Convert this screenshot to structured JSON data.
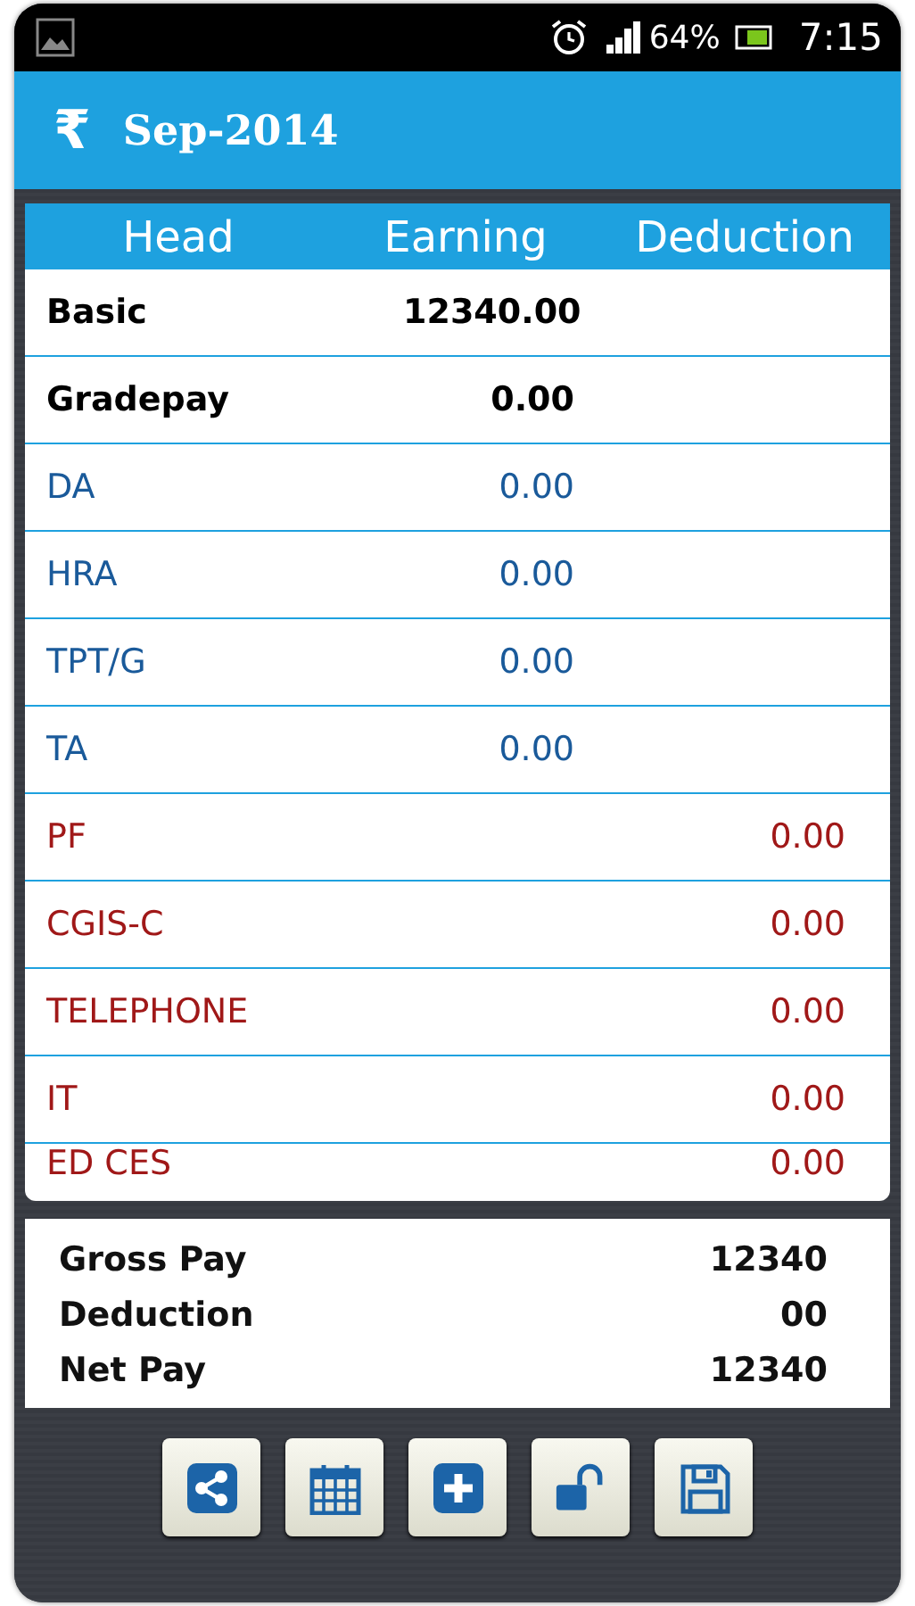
{
  "status_bar": {
    "battery": "64%",
    "time": "7:15"
  },
  "app_bar": {
    "currency_symbol": "₹",
    "title": "Sep-2014"
  },
  "table": {
    "columns": [
      "Head",
      "Earning",
      "Deduction"
    ],
    "rows": [
      {
        "kind": "basic",
        "head": "Basic",
        "earning": "12340.00"
      },
      {
        "kind": "basic",
        "head": "Gradepay",
        "earning": "0.00"
      },
      {
        "kind": "earning",
        "head": "DA",
        "earning": "0.00"
      },
      {
        "kind": "earning",
        "head": "HRA",
        "earning": "0.00"
      },
      {
        "kind": "earning",
        "head": "TPT/G",
        "earning": "0.00"
      },
      {
        "kind": "earning",
        "head": "TA",
        "earning": "0.00"
      },
      {
        "kind": "deduction",
        "head": "PF",
        "deduction": "0.00"
      },
      {
        "kind": "deduction",
        "head": "CGIS-C",
        "deduction": "0.00"
      },
      {
        "kind": "deduction",
        "head": "TELEPHONE",
        "deduction": "0.00"
      },
      {
        "kind": "deduction",
        "head": "IT",
        "deduction": "0.00"
      },
      {
        "kind": "deduction",
        "head": "ED CES",
        "deduction": "0.00"
      }
    ]
  },
  "summary": [
    {
      "label": "Gross Pay",
      "value": "12340"
    },
    {
      "label": "Deduction",
      "value": "00"
    },
    {
      "label": "Net Pay",
      "value": "12340"
    }
  ],
  "toolbar": [
    {
      "kind": "share"
    },
    {
      "kind": "calendar"
    },
    {
      "kind": "add"
    },
    {
      "kind": "unlock"
    },
    {
      "kind": "save"
    }
  ]
}
